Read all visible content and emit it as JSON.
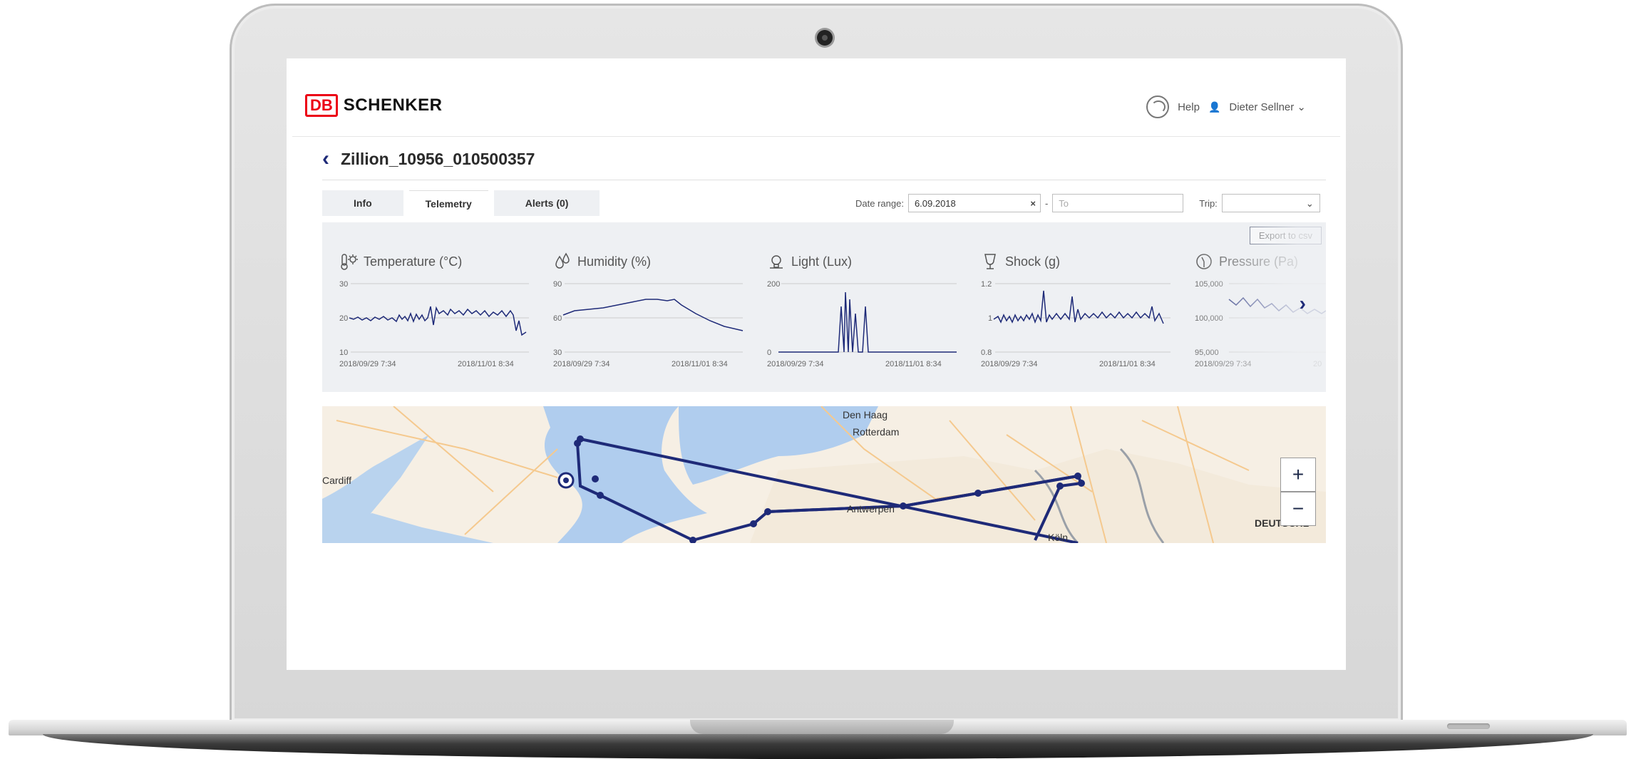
{
  "header": {
    "logo_db": "DB",
    "logo_name": "SCHENKER",
    "help": "Help",
    "user": "Dieter Sellner",
    "user_caret": "⌄"
  },
  "page": {
    "title": "Zillion_10956_010500357"
  },
  "tabs": [
    {
      "label": "Info",
      "active": false
    },
    {
      "label": "Telemetry",
      "active": true
    },
    {
      "label": "Alerts (0)",
      "active": false
    }
  ],
  "filters": {
    "date_range_label": "Date range:",
    "date_from": "6.09.2018",
    "date_sep": "-",
    "date_to_placeholder": "To",
    "trip_label": "Trip:",
    "trip_value": ""
  },
  "export_label": "Export to csv",
  "metrics": [
    {
      "title": "Temperature (°C)",
      "icon": "thermometer-icon",
      "y_ticks": [
        "30",
        "20",
        "10"
      ],
      "x_start": "2018/09/29 7:34",
      "x_end": "2018/11/01 8:34"
    },
    {
      "title": "Humidity (%)",
      "icon": "droplets-icon",
      "y_ticks": [
        "90",
        "60",
        "30"
      ],
      "x_start": "2018/09/29 7:34",
      "x_end": "2018/11/01 8:34"
    },
    {
      "title": "Light (Lux)",
      "icon": "bulb-icon",
      "y_ticks": [
        "200",
        "",
        "0"
      ],
      "x_start": "2018/09/29 7:34",
      "x_end": "2018/11/01 8:34"
    },
    {
      "title": "Shock (g)",
      "icon": "glass-icon",
      "y_ticks": [
        "1.2",
        "1",
        "0.8"
      ],
      "x_start": "2018/09/29 7:34",
      "x_end": "2018/11/01 8:34"
    },
    {
      "title": "Pressure (Pa)",
      "icon": "gauge-icon",
      "y_ticks": [
        "105,000",
        "100,000",
        "95,000"
      ],
      "x_start": "2018/09/29 7:34",
      "x_end": "20"
    }
  ],
  "map": {
    "labels": [
      "Den Haag",
      "Rotterdam",
      "Cardiff",
      "Antwerpen",
      "Köln",
      "DEUTSCHL"
    ],
    "zoom_in": "+",
    "zoom_out": "−"
  },
  "colors": {
    "brand_red": "#ec0016",
    "navy": "#1e2a78",
    "panel_bg": "#eef0f3"
  }
}
